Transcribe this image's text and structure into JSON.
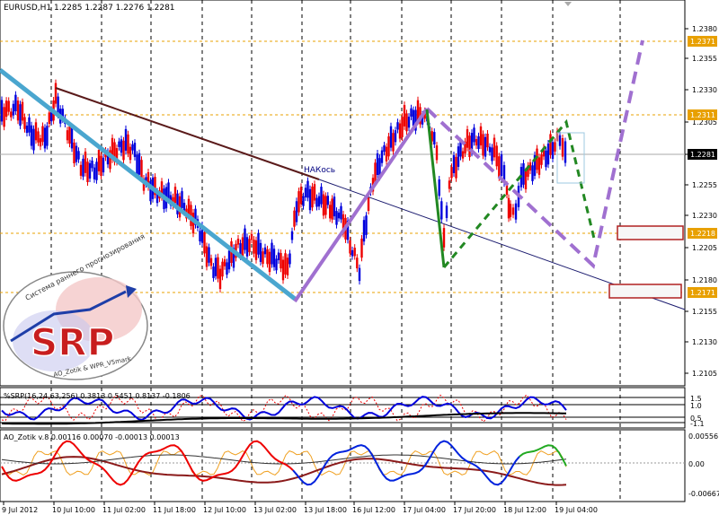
{
  "main_chart": {
    "header": "EURUSD,H1  1.2285 1.2287 1.2276 1.2281",
    "price_labels": [
      "1.2380",
      "1.2355",
      "1.2330",
      "1.2305",
      "1.2280",
      "1.2255",
      "1.2230",
      "1.2205",
      "1.2180",
      "1.2155",
      "1.2130",
      "1.2105"
    ],
    "level_labels": [
      "1.2371",
      "1.2311",
      "1.2218",
      "1.2171"
    ],
    "current_price": "1.2281",
    "annotation": "НАКось",
    "logo": {
      "text": "SRP",
      "arc_text_top": "Система раннего прогнозирования",
      "arc_text_bottom": "AO_Zotik & WPR_V5mark"
    },
    "colors": {
      "bull": "#0000dd",
      "bear": "#ee0000",
      "trend_cyan": "#4aa6cf",
      "trend_maroon": "#5a1a1a",
      "zigzag_purple": "#a070d0",
      "zigzag_green": "#228822",
      "level_orange": "#e8a000"
    }
  },
  "indicator1": {
    "header": "%SRP(16,24,63,256) 0.3813 0.5451 0.8137 -0.1806",
    "scale_labels": [
      "1.5",
      "1.0",
      "0.5",
      "-1.1"
    ]
  },
  "indicator2": {
    "header": "AO_Zotik v.8 0.00116 0.00070 -0.00013 0.00013",
    "scale_labels": [
      "0.00556",
      "0.00",
      "-0.00667"
    ]
  },
  "time_axis": {
    "labels": [
      "9 Jul 2012",
      "10 Jul 10:00",
      "11 Jul 02:00",
      "11 Jul 18:00",
      "12 Jul 10:00",
      "13 Jul 02:00",
      "13 Jul 18:00",
      "16 Jul 12:00",
      "17 Jul 04:00",
      "17 Jul 20:00",
      "18 Jul 12:00",
      "19 Jul 04:00"
    ]
  }
}
